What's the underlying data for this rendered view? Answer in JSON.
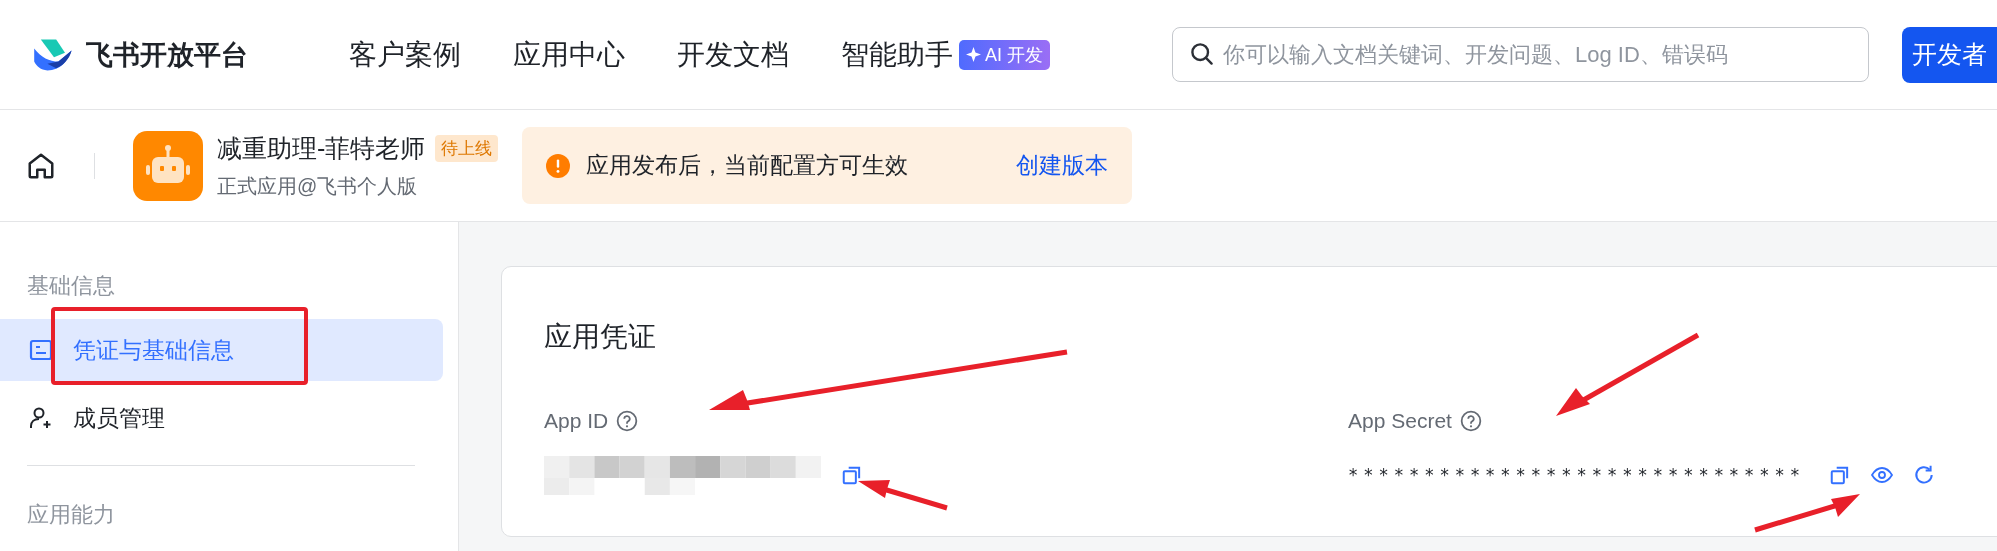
{
  "top_nav": {
    "logo": "飞书开放平台",
    "links": [
      {
        "label": "客户案例"
      },
      {
        "label": "应用中心"
      },
      {
        "label": "开发文档"
      },
      {
        "label": "智能助手",
        "badge": "AI 开发"
      }
    ],
    "search": {
      "placeholder": "你可以输入文档关键词、开发问题、Log ID、错误码"
    },
    "button": "开发者"
  },
  "app_header": {
    "name": "减重助理-菲特老师",
    "status": "待上线",
    "subtitle": "正式应用@飞书个人版",
    "notice": {
      "text": "应用发布后，当前配置方可生效",
      "action": "创建版本"
    }
  },
  "sidebar": {
    "sections": [
      {
        "title": "基础信息",
        "items": [
          {
            "label": "凭证与基础信息",
            "selected": true,
            "kind": "doc"
          },
          {
            "label": "成员管理",
            "selected": false,
            "kind": "member"
          }
        ]
      },
      {
        "title": "应用能力"
      }
    ]
  },
  "card": {
    "title": "应用凭证",
    "fields": [
      {
        "label": "App ID",
        "kind": "redacted"
      },
      {
        "label": "App Secret",
        "kind": "masked",
        "value": "******************************"
      }
    ]
  }
}
